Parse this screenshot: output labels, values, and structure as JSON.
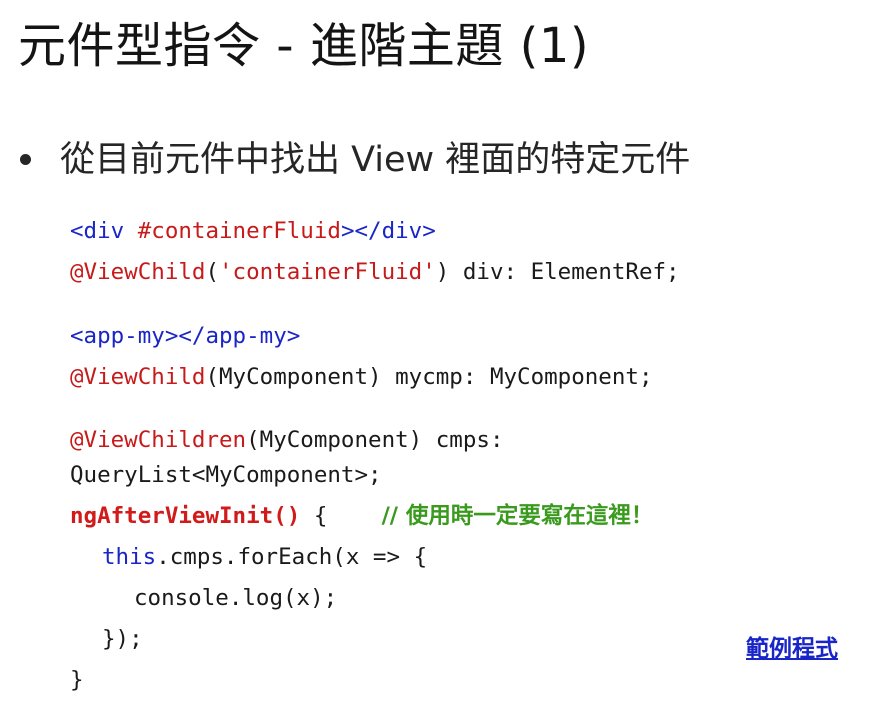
{
  "slide": {
    "title": "元件型指令 - 進階主題 (1)",
    "bullet": "從目前元件中找出 View 裡面的特定元件",
    "link_label": "範例程式"
  },
  "code": {
    "l1": {
      "tag_open": "<div",
      "ref": " #containerFluid",
      "tag_close": "></div>"
    },
    "l2": {
      "decorator": "@ViewChild",
      "p1": "(",
      "arg": "'containerFluid'",
      "rest": ") div: ElementRef;"
    },
    "l3": {
      "tag": "<app-my></app-my>"
    },
    "l4": {
      "decorator": "@ViewChild",
      "rest": "(MyComponent) mycmp: MyComponent;"
    },
    "l5": {
      "decorator": "@ViewChildren",
      "rest": "(MyComponent) cmps:"
    },
    "l6": {
      "text": "QueryList<MyComponent>;"
    },
    "l7": {
      "method": "ngAfterViewInit()",
      "brace": " {    ",
      "comment": "// 使用時一定要寫在這裡！"
    },
    "l8": {
      "kw": "this",
      "rest": ".cmps.forEach(x => {"
    },
    "l9": {
      "text": "console.log(x);"
    },
    "l10": {
      "text": "});"
    },
    "l11": {
      "text": "}"
    }
  },
  "colors": {
    "tag": "#1a25c7",
    "decorator": "#c71a1a",
    "comment": "#3a9a1e",
    "link": "#1a25c7"
  }
}
